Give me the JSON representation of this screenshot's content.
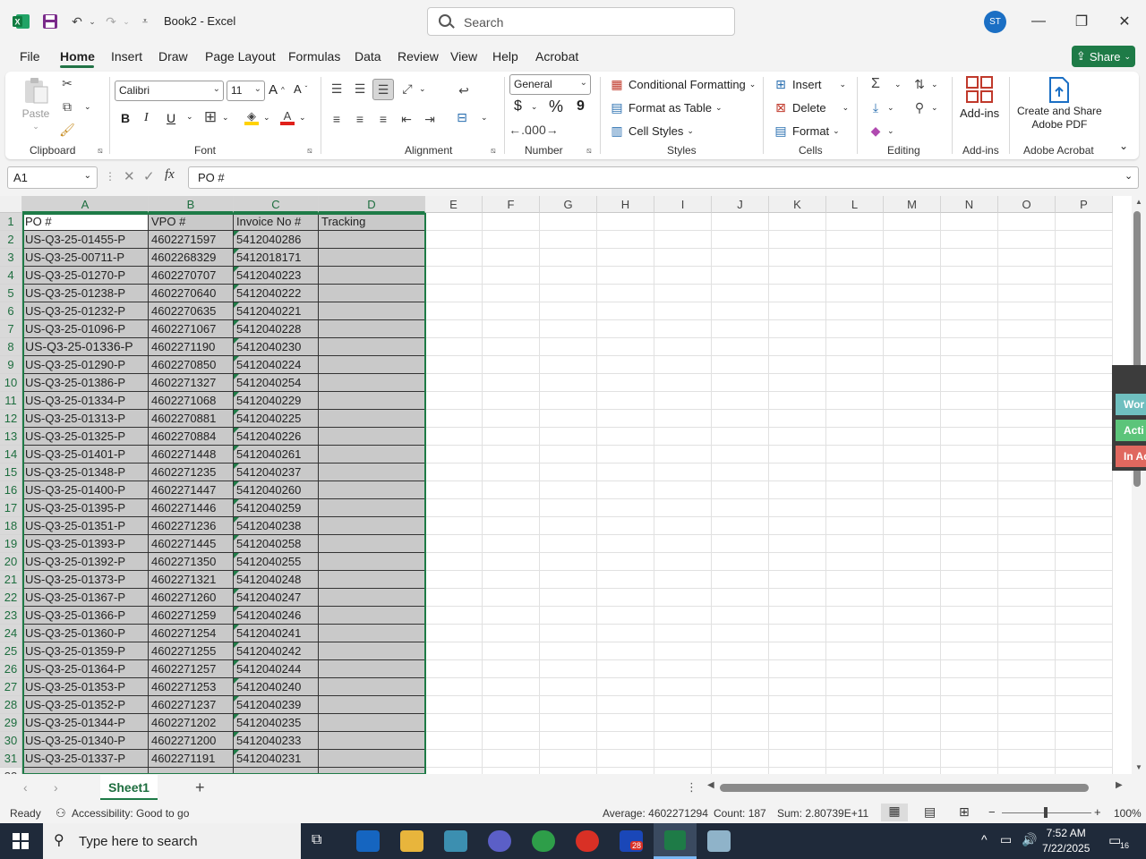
{
  "titlebar": {
    "doc_title": "Book2 - Excel",
    "search_placeholder": "Search",
    "avatar_initials": "ST"
  },
  "menu": {
    "tabs": [
      "File",
      "Home",
      "Insert",
      "Draw",
      "Page Layout",
      "Formulas",
      "Data",
      "Review",
      "View",
      "Help",
      "Acrobat"
    ],
    "share_label": "Share"
  },
  "ribbon": {
    "clipboard": {
      "paste_label": "Paste",
      "group_label": "Clipboard"
    },
    "font": {
      "font_name": "Calibri",
      "font_size": "11",
      "group_label": "Font",
      "bold": "B",
      "italic": "I",
      "underline": "U"
    },
    "alignment": {
      "group_label": "Alignment"
    },
    "number": {
      "format": "General",
      "currency": "$",
      "percent": "%",
      "comma": "9",
      "group_label": "Number"
    },
    "styles": {
      "conditional": "Conditional Formatting",
      "format_table": "Format as Table",
      "cell_styles": "Cell Styles",
      "group_label": "Styles"
    },
    "cells": {
      "insert": "Insert",
      "delete": "Delete",
      "format": "Format",
      "group_label": "Cells"
    },
    "editing": {
      "group_label": "Editing"
    },
    "addins": {
      "label": "Add-ins",
      "group_label": "Add-ins"
    },
    "acrobat": {
      "label_line1": "Create and Share",
      "label_line2": "Adobe PDF",
      "group_label": "Adobe Acrobat"
    }
  },
  "formula_bar": {
    "name_box": "A1",
    "content": "PO #"
  },
  "grid": {
    "columns": [
      "A",
      "B",
      "C",
      "D",
      "E",
      "F",
      "G",
      "H",
      "I",
      "J",
      "K",
      "L",
      "M",
      "N",
      "O",
      "P"
    ],
    "rows": [
      [
        "PO #",
        "VPO #",
        "Invoice No #",
        "Tracking"
      ],
      [
        "US-Q3-25-01455-P",
        "4602271597",
        "5412040286",
        ""
      ],
      [
        "US-Q3-25-00711-P",
        "4602268329",
        "5412018171",
        ""
      ],
      [
        "US-Q3-25-01270-P",
        "4602270707",
        "5412040223",
        ""
      ],
      [
        "US-Q3-25-01238-P",
        "4602270640",
        "5412040222",
        ""
      ],
      [
        "US-Q3-25-01232-P",
        "4602270635",
        "5412040221",
        ""
      ],
      [
        "US-Q3-25-01096-P",
        "4602271067",
        "5412040228",
        ""
      ],
      [
        "US-Q3-25-01336-P",
        "4602271190",
        "5412040230",
        ""
      ],
      [
        "US-Q3-25-01290-P",
        "4602270850",
        "5412040224",
        ""
      ],
      [
        "US-Q3-25-01386-P",
        "4602271327",
        "5412040254",
        ""
      ],
      [
        "US-Q3-25-01334-P",
        "4602271068",
        "5412040229",
        ""
      ],
      [
        "US-Q3-25-01313-P",
        "4602270881",
        "5412040225",
        ""
      ],
      [
        "US-Q3-25-01325-P",
        "4602270884",
        "5412040226",
        ""
      ],
      [
        "US-Q3-25-01401-P",
        "4602271448",
        "5412040261",
        ""
      ],
      [
        "US-Q3-25-01348-P",
        "4602271235",
        "5412040237",
        ""
      ],
      [
        "US-Q3-25-01400-P",
        "4602271447",
        "5412040260",
        ""
      ],
      [
        "US-Q3-25-01395-P",
        "4602271446",
        "5412040259",
        ""
      ],
      [
        "US-Q3-25-01351-P",
        "4602271236",
        "5412040238",
        ""
      ],
      [
        "US-Q3-25-01393-P",
        "4602271445",
        "5412040258",
        ""
      ],
      [
        "US-Q3-25-01392-P",
        "4602271350",
        "5412040255",
        ""
      ],
      [
        "US-Q3-25-01373-P",
        "4602271321",
        "5412040248",
        ""
      ],
      [
        "US-Q3-25-01367-P",
        "4602271260",
        "5412040247",
        ""
      ],
      [
        "US-Q3-25-01366-P",
        "4602271259",
        "5412040246",
        ""
      ],
      [
        "US-Q3-25-01360-P",
        "4602271254",
        "5412040241",
        ""
      ],
      [
        "US-Q3-25-01359-P",
        "4602271255",
        "5412040242",
        ""
      ],
      [
        "US-Q3-25-01364-P",
        "4602271257",
        "5412040244",
        ""
      ],
      [
        "US-Q3-25-01353-P",
        "4602271253",
        "5412040240",
        ""
      ],
      [
        "US-Q3-25-01352-P",
        "4602271237",
        "5412040239",
        ""
      ],
      [
        "US-Q3-25-01344-P",
        "4602271202",
        "5412040235",
        ""
      ],
      [
        "US-Q3-25-01340-P",
        "4602271200",
        "5412040233",
        ""
      ],
      [
        "US-Q3-25-01337-P",
        "4602271191",
        "5412040231",
        ""
      ]
    ]
  },
  "side_panel": {
    "tabs": [
      "Wor",
      "Acti",
      "In Ac"
    ]
  },
  "sheets": {
    "active": "Sheet1",
    "add": "+"
  },
  "status": {
    "mode": "Ready",
    "accessibility": "Accessibility: Good to go",
    "average": "Average: 4602271294",
    "count": "Count: 187",
    "sum": "Sum: 2.80739E+11",
    "zoom": "100%"
  },
  "taskbar": {
    "search_text": "Type here to search",
    "time": "7:52 AM",
    "date": "7/22/2025",
    "notif_count": "16",
    "zoom_badge": "28"
  },
  "colors": {
    "excel_green": "#1e7b47",
    "selection_gray": "#c9c9c9",
    "accent_blue": "#1b6fc4"
  }
}
